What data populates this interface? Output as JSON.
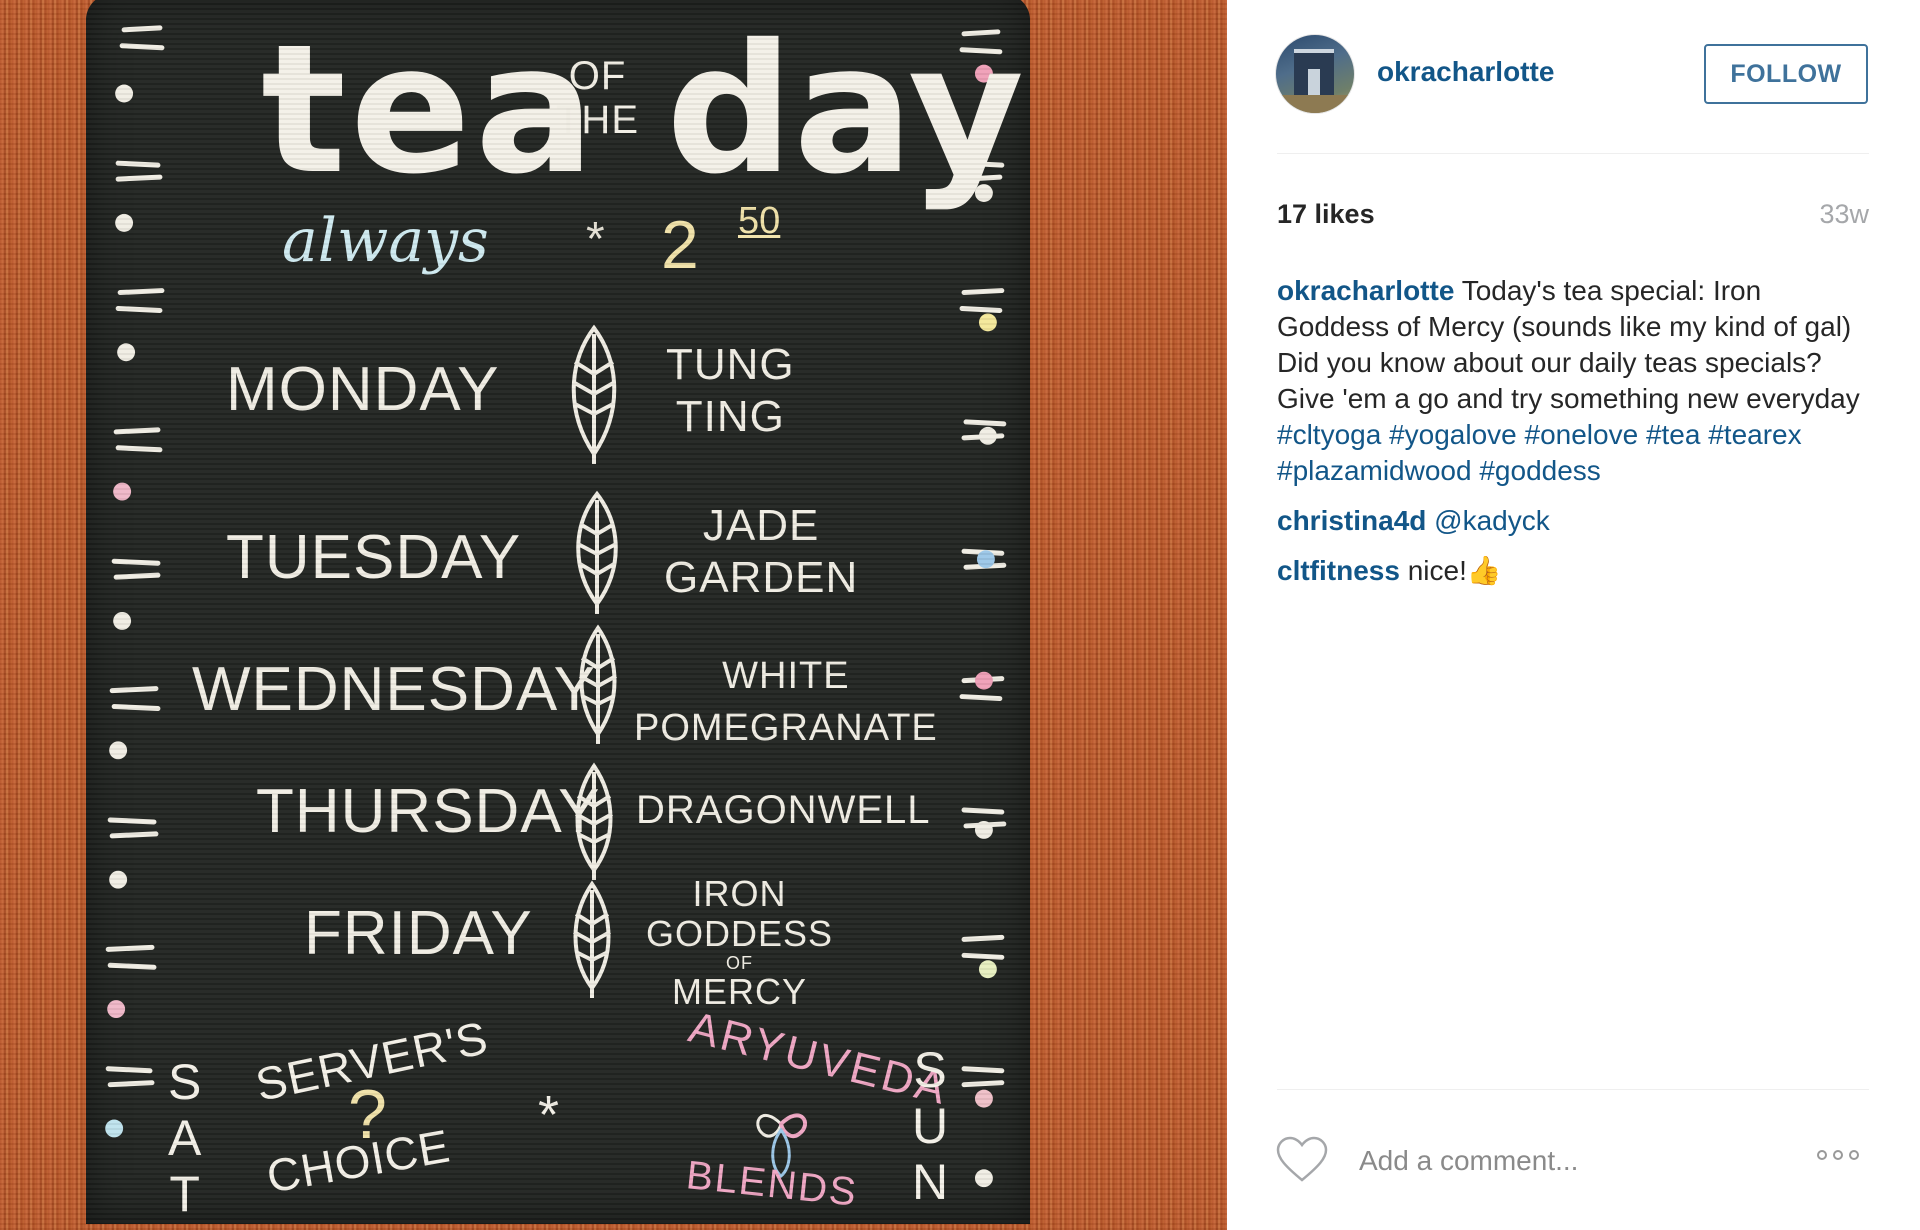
{
  "photo": {
    "title_tea": "tea",
    "title_of": "OF",
    "title_the": "THE",
    "title_day": "day",
    "always": "always",
    "star": "*",
    "price_dollars": "2",
    "price_cents": "50",
    "schedule": [
      {
        "day": "MONDAY",
        "tea_line1": "TUNG",
        "tea_line2": "TING"
      },
      {
        "day": "TUESDAY",
        "tea_line1": "JADE",
        "tea_line2": "GARDEN"
      },
      {
        "day": "WEDNESDAY",
        "tea_line1": "WHITE",
        "tea_line2": "POMEGRANATE"
      },
      {
        "day": "THURSDAY",
        "tea_line1": "DRAGONWELL",
        "tea_line2": ""
      },
      {
        "day": "FRIDAY",
        "tea_line1": "IRON",
        "tea_line2": "GODDESS",
        "tea_line3": "OF",
        "tea_line4": "MERCY"
      }
    ],
    "weekend": {
      "sat_1": "S",
      "sat_2": "A",
      "sat_3": "T",
      "sun_1": "S",
      "sun_2": "U",
      "sun_3": "N",
      "server": "SERVER'S",
      "question": "?",
      "choice": "CHOICE",
      "mid_star": "*",
      "ayurveda": "ARYUVEDA",
      "blends": "BLENDS"
    }
  },
  "post": {
    "username": "okracharlotte",
    "follow_label": "FOLLOW",
    "likes": "17 likes",
    "age": "33w",
    "caption_user": "okracharlotte",
    "caption_text": "Today's tea special: Iron Goddess of Mercy (sounds like my kind of gal) Did you know about our daily teas specials? Give 'em a go and try something new everyday ",
    "hashtags": [
      "#cltyoga",
      "#yogalove",
      "#onelove",
      "#tea",
      "#tearex",
      "#plazamidwood",
      "#goddess"
    ],
    "comments": [
      {
        "user": "christina4d",
        "text": "@kadyck"
      },
      {
        "user": "cltfitness",
        "text": "nice!👍"
      }
    ],
    "add_comment_placeholder": "Add a comment..."
  }
}
